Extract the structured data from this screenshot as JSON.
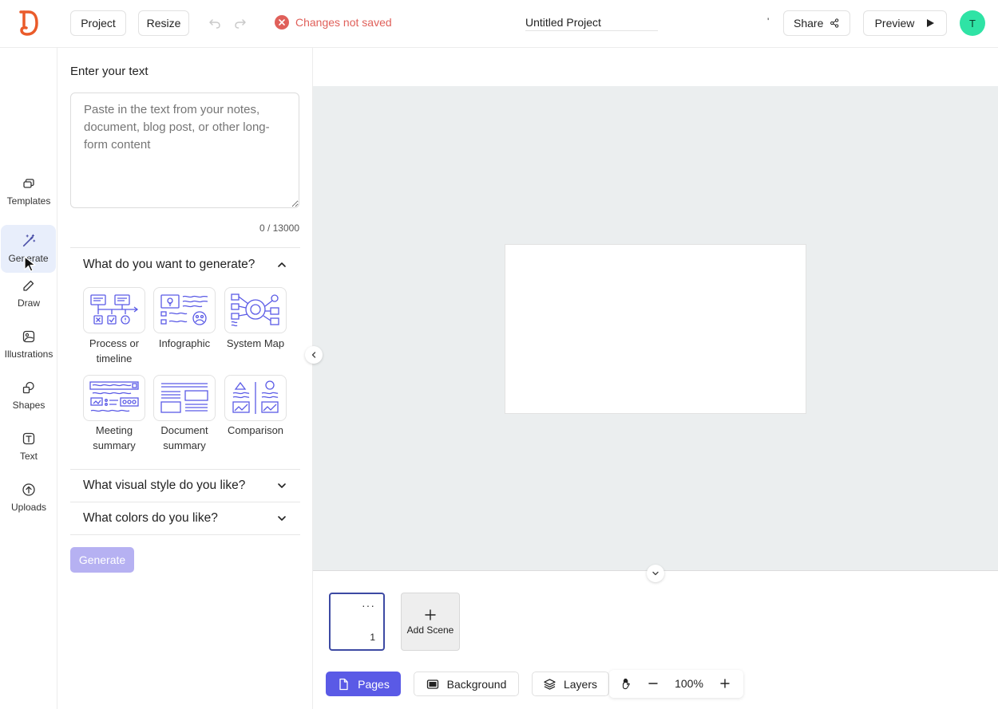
{
  "topbar": {
    "project_label": "Project",
    "resize_label": "Resize",
    "unsaved_status": "Changes not saved",
    "project_title": "Untitled Project",
    "tick_mark": "'",
    "share_label": "Share",
    "preview_label": "Preview",
    "avatar_initial": "T",
    "colors": {
      "logo": "#ea5b2a",
      "unsaved": "#e0605a",
      "avatar": "#2fe3a5"
    }
  },
  "rail": {
    "items": [
      {
        "label": "Templates",
        "icon": "templates-icon"
      },
      {
        "label": "Generate",
        "icon": "magic-wand-icon",
        "active": true
      },
      {
        "label": "Draw",
        "icon": "pencil-icon"
      },
      {
        "label": "Illustrations",
        "icon": "illustration-icon"
      },
      {
        "label": "Shapes",
        "icon": "shapes-icon"
      },
      {
        "label": "Text",
        "icon": "text-icon"
      },
      {
        "label": "Uploads",
        "icon": "upload-icon"
      }
    ]
  },
  "panel": {
    "title": "Enter your text",
    "textarea_placeholder": "Paste in the text from your notes, document, blog post, or other long-form content",
    "char_count": "0 / 13000",
    "generate_section": {
      "heading": "What do you want to generate?",
      "options": [
        {
          "label": "Process or timeline",
          "icon": "process-timeline-icon"
        },
        {
          "label": "Infographic",
          "icon": "infographic-icon"
        },
        {
          "label": "System Map",
          "icon": "system-map-icon"
        },
        {
          "label": "Meeting summary",
          "icon": "meeting-summary-icon"
        },
        {
          "label": "Document summary",
          "icon": "document-summary-icon"
        },
        {
          "label": "Comparison",
          "icon": "comparison-icon"
        }
      ]
    },
    "style_heading": "What visual style do you like?",
    "colors_heading": "What colors do you like?",
    "generate_button": "Generate",
    "colors": {
      "accent": "#5a5ae6",
      "generate_disabled": "#b6b1f2"
    }
  },
  "scenes": {
    "thumb_menu": "···",
    "thumb_number": "1",
    "add_scene_label": "Add Scene"
  },
  "bottombar": {
    "pages_label": "Pages",
    "background_label": "Background",
    "layers_label": "Layers",
    "zoom_level": "100%"
  }
}
